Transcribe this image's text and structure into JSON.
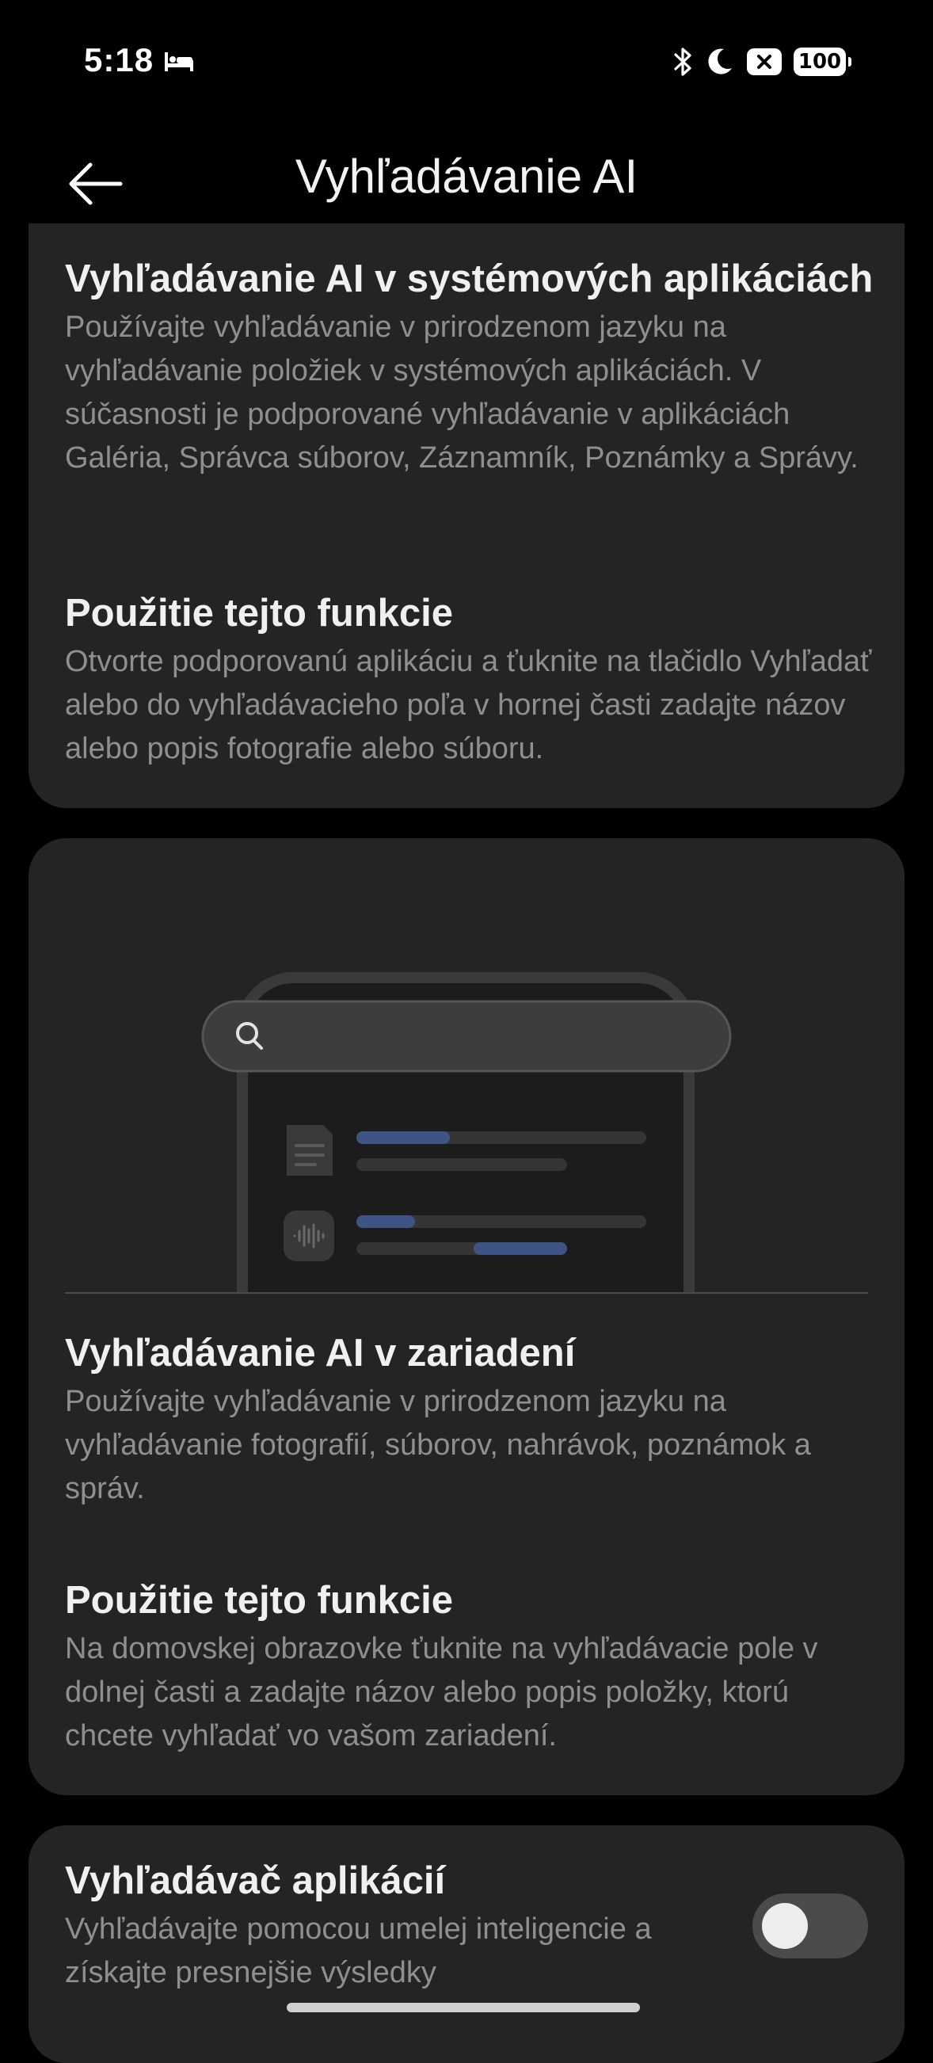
{
  "status_bar": {
    "time": "5:18",
    "battery": "100",
    "icons": [
      "sleep-icon",
      "bluetooth-icon",
      "moon-icon",
      "notification-x-icon",
      "battery-icon"
    ]
  },
  "header": {
    "title": "Vyhľadávanie AI",
    "back_icon": "arrow-left-icon"
  },
  "cards": [
    {
      "sections": [
        {
          "title": "Vyhľadávanie AI v systémových aplikáciách",
          "description": "Používajte vyhľadávanie v prirodzenom jazyku na vyhľadávanie položiek v systémových aplikáciách. V súčasnosti je podporované vyhľadávanie v aplikáciách Galéria, Správca súborov, Záznamník, Poznámky a Správy."
        },
        {
          "title": "Použitie tejto funkcie",
          "description": "Otvorte podporovanú aplikáciu a ťuknite na tlačidlo Vyhľadať alebo do vyhľadávacieho poľa v hornej časti zadajte názov alebo popis fotografie alebo súboru."
        }
      ]
    },
    {
      "illustration": {
        "icons": [
          "search-icon",
          "document-icon",
          "audio-waveform-icon"
        ],
        "accent_color": "#3D5484"
      },
      "sections": [
        {
          "title": "Vyhľadávanie AI v zariadení",
          "description": "Používajte vyhľadávanie v prirodzenom jazyku na vyhľadávanie fotografií, súborov, nahrávok, poznámok a správ."
        },
        {
          "title": "Použitie tejto funkcie",
          "description": "Na domovskej obrazovke ťuknite na vyhľadávacie pole v dolnej časti a zadajte názov alebo popis položky, ktorú chcete vyhľadať vo vašom zariadení."
        }
      ]
    },
    {
      "sections": [
        {
          "title": "Vyhľadávač aplikácií",
          "description": "Vyhľadávajte pomocou umelej inteligencie a získajte presnejšie výsledky"
        }
      ],
      "toggle": {
        "state": "off"
      }
    }
  ],
  "colors": {
    "background": "#000000",
    "card": "#242424",
    "title_text": "#F0F0F0",
    "description_text": "#8F8F8F",
    "toggle_off": "#4B4B4B"
  }
}
